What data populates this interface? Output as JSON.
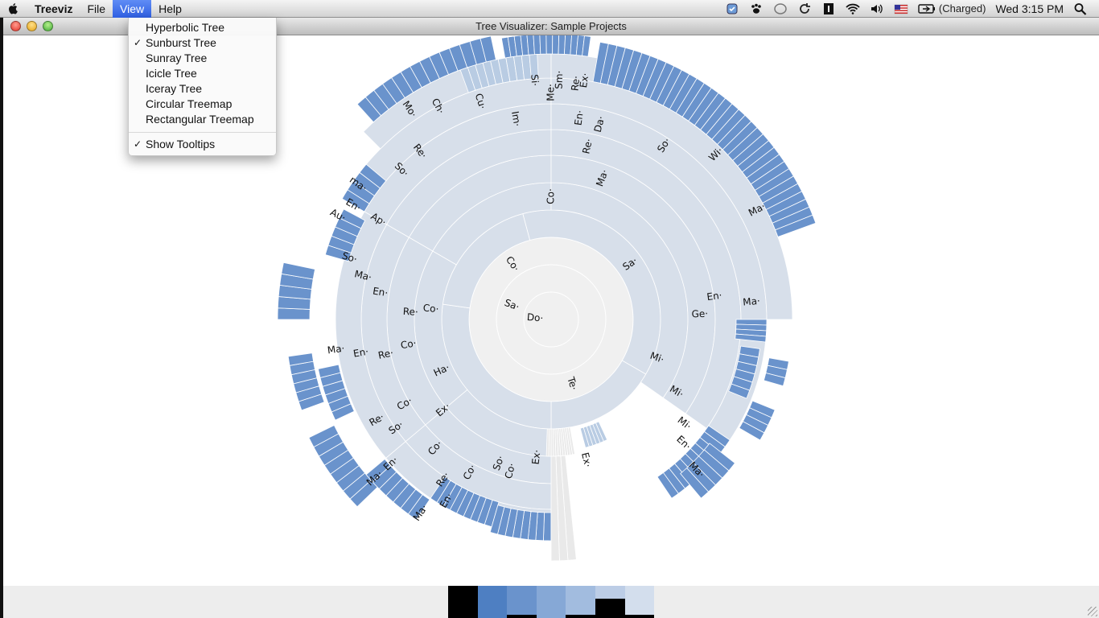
{
  "menubar": {
    "app_name": "Treeviz",
    "menus": [
      "File",
      "View",
      "Help"
    ],
    "active_menu": "View",
    "battery_status": "(Charged)",
    "clock": "Wed 3:15 PM",
    "icons": [
      "apple-icon",
      "sync-status-icon",
      "paw-icon",
      "bubble-icon",
      "time-machine-icon",
      "one-password-icon",
      "wifi-icon",
      "volume-icon",
      "us-flag-icon",
      "battery-icon",
      "spotlight-icon"
    ]
  },
  "window": {
    "title": "Tree Visualizer: Sample Projects"
  },
  "view_menu": {
    "items": [
      {
        "label": "Hyperbolic Tree",
        "checked": false
      },
      {
        "label": "Sunburst Tree",
        "checked": true
      },
      {
        "label": "Sunray Tree",
        "checked": false
      },
      {
        "label": "Icicle Tree",
        "checked": false
      },
      {
        "label": "Iceray Tree",
        "checked": false
      },
      {
        "label": "Circular Treemap",
        "checked": false
      },
      {
        "label": "Rectangular Treemap",
        "checked": false
      }
    ],
    "toggle": {
      "label": "Show Tooltips",
      "checked": true
    },
    "check_glyph": "✓"
  },
  "sunburst": {
    "colors": {
      "core": "#f0f0f0",
      "mid": "#d7dfea",
      "leaf": "#6a93cc",
      "light": "#b9cce3",
      "ghost": "#e9e9e9",
      "stroke": "#ffffff"
    },
    "labels": {
      "core": [
        "Co·",
        "Sa·",
        "Do·",
        "Te·"
      ],
      "ring1": [
        "Sa·",
        "Co·",
        "Ma·",
        "Re·",
        "En·",
        "Im·",
        "Cu·",
        "Ch·",
        "Mo·",
        "So·",
        "Re·",
        "En·",
        "ma·",
        "Au·",
        "Ap·",
        "Da·",
        "So·",
        "Wi·",
        "Ma·",
        "Me·",
        "Re·",
        "Si·",
        "Sm·",
        "Ex·",
        "Co·",
        "Re·",
        "En·",
        "Ma·",
        "So·",
        "Co·",
        "Re·",
        "En·",
        "Ma·",
        "Ha·",
        "Ex·",
        "Co·",
        "So·",
        "Re·",
        "En·",
        "Ma·",
        "Co·",
        "Re·",
        "En·",
        "Ma·",
        "So·",
        "Co·",
        "Co·",
        "Ex·",
        "Ex·",
        "Ge·",
        "En·",
        "Ma·",
        "Mi·",
        "Mi·",
        "Mi·",
        "En·",
        "Ma·"
      ]
    }
  },
  "palette": {
    "swatches": [
      {
        "color": "#000000",
        "level": 1.0
      },
      {
        "color": "#4e7fc2",
        "level": 0.0
      },
      {
        "color": "#6a93cc",
        "level": 0.1
      },
      {
        "color": "#86a8d6",
        "level": 0.0
      },
      {
        "color": "#a2bcdf",
        "level": 0.1
      },
      {
        "color": "#bccde6",
        "level": 0.6
      },
      {
        "color": "#d3deed",
        "level": 0.1
      }
    ]
  }
}
